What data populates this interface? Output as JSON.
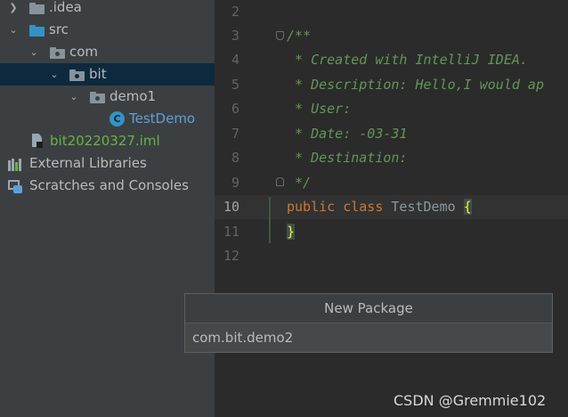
{
  "project_tree": {
    "idea_label": ".idea",
    "src_label": "src",
    "com_label": "com",
    "bit_label": "bit",
    "demo1_label": "demo1",
    "testdemo_label": "TestDemo",
    "iml_label": "bit20220327.iml",
    "external_libraries_label": "External Libraries",
    "scratches_label": "Scratches and Consoles",
    "class_icon_letter": "C"
  },
  "editor": {
    "line_numbers": [
      "2",
      "3",
      "4",
      "5",
      "6",
      "7",
      "8",
      "9",
      "10",
      "11",
      "12"
    ],
    "current_line": "10",
    "lines": {
      "l3": "/**",
      "l4": " * Created with IntelliJ IDEA.",
      "l5": " * Description: Hello,I would ap",
      "l6": " * User:",
      "l7": " * Date: -03-31",
      "l8": " * Destination:",
      "l9": " */",
      "l10_kw1": "public",
      "l10_kw2": "class",
      "l10_name": "TestDemo",
      "l10_brace": "{",
      "l11_brace": "}"
    }
  },
  "new_package_dialog": {
    "title": "New Package",
    "input_value": "com.bit.demo2"
  },
  "watermark": "CSDN @Gremmie102",
  "colors": {
    "tree_background": "#3c3f41",
    "selection": "#0d293e",
    "editor_background": "#2b2b2b",
    "doc_comment": "#629755",
    "keyword": "#cc7832"
  }
}
